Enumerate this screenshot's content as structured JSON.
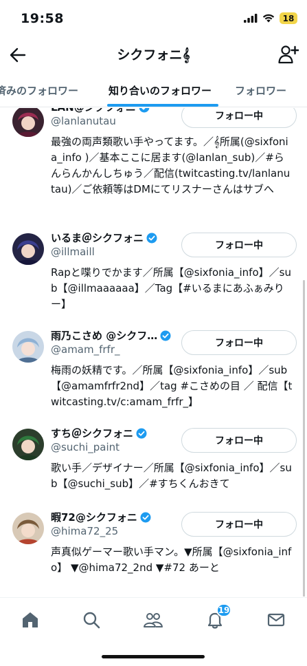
{
  "status_bar": {
    "time": "19:58",
    "battery": "18"
  },
  "header": {
    "title": "シクフォニ𝄞"
  },
  "tabs": [
    {
      "label": "済みのフォロワー"
    },
    {
      "label": "知り合いのフォロワー"
    },
    {
      "label": "フォロワー"
    }
  ],
  "users": [
    {
      "name": "LAN@シクフォニ",
      "handle": "@lanlanutau",
      "button": "フォロー中",
      "bio": "最強の両声類歌い手やってます。／𝄞所属(@sixfonia_info )／基本ここに居ます(@lanlan_sub)／#らんらんかんしちゅう／配信(twitcasting.tv/lanlanutau)／ご依頼等はDMにてリスナーさんはサブへ"
    },
    {
      "name": "いるま＠シクフォニ",
      "handle": "@illmaill",
      "button": "フォロー中",
      "bio": "Rapと喋りでかます／所属【@sixfonia_info】／sub【@illmaaaaaa】／Tag【#いるまにあふぁみりー】"
    },
    {
      "name": "雨乃こさめ @シクフ…",
      "handle": "@amam_frfr_",
      "button": "フォロー中",
      "bio": "梅雨の妖精です。／所属【@sixfonia_info】／sub【@amamfrfr2nd】／tag #こさめの目 ／ 配信【twitcasting.tv/c:amam_frfr_】"
    },
    {
      "name": "すち＠シクフォニ",
      "handle": "@suchi_paint",
      "button": "フォロー中",
      "bio": "歌い手／デザイナー／所属【@sixfonia_info】／sub【@suchi_sub】／#すちくんおきて"
    },
    {
      "name": "暇72@シクフォニ",
      "handle": "@hima72_25",
      "button": "フォロー中",
      "bio": "声真似ゲーマー歌い手マン。▼所属【@sixfonia_info】 ▼@hima72_2nd ▼#72 あーと"
    }
  ],
  "nav": {
    "notifications_badge": "19"
  },
  "colors": {
    "accent": "#1d9bf0",
    "text": "#0f1419",
    "secondary": "#536471"
  }
}
